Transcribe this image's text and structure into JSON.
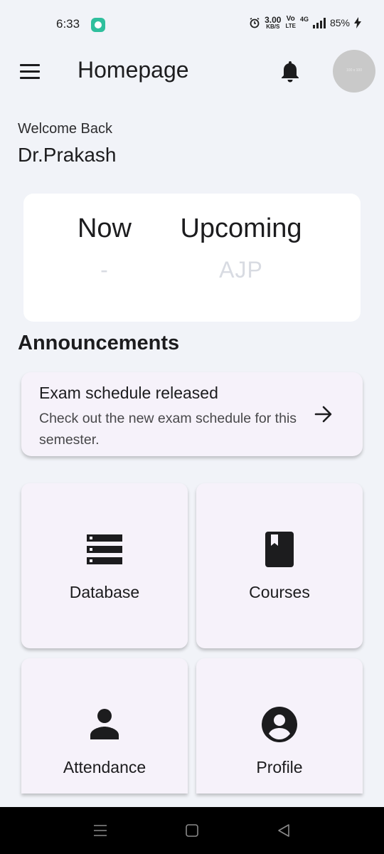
{
  "status_bar": {
    "time": "6:33",
    "speed_value": "3.00",
    "speed_unit": "KB/S",
    "volte_top": "Vo",
    "volte_bottom": "LTE",
    "network": "4G",
    "battery": "85%"
  },
  "app_bar": {
    "title": "Homepage",
    "avatar_placeholder": "100 x 100"
  },
  "welcome": {
    "greeting": "Welcome Back",
    "name": "Dr.Prakash"
  },
  "class_card": {
    "now_label": "Now",
    "now_value": "-",
    "upcoming_label": "Upcoming",
    "upcoming_value": "AJP"
  },
  "announcements": {
    "heading": "Announcements",
    "items": [
      {
        "title": "Exam schedule released",
        "description": "Check out the new exam schedule for this semester."
      }
    ]
  },
  "tiles": [
    {
      "label": "Database",
      "icon": "storage-icon"
    },
    {
      "label": "Courses",
      "icon": "book-icon"
    },
    {
      "label": "Attendance",
      "icon": "person-icon"
    },
    {
      "label": "Profile",
      "icon": "account-circle-icon"
    }
  ],
  "colors": {
    "background": "#f1f3f8",
    "card": "#ffffff",
    "tile": "#f6f2fa",
    "text": "#1c1c1e",
    "muted_value": "#d8dbe2",
    "status_chat": "#2fbf9d"
  }
}
